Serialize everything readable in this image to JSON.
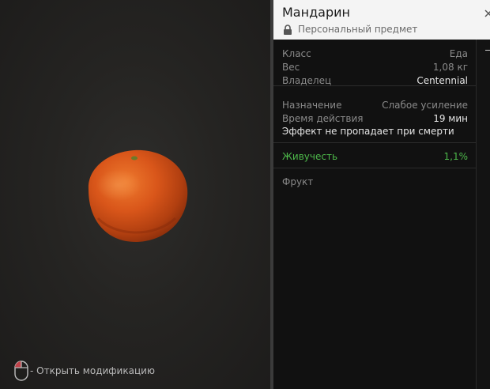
{
  "item": {
    "name": "Мандарин",
    "ownership": "Персональный предмет"
  },
  "props": [
    {
      "label": "Класс",
      "value": "Еда"
    },
    {
      "label": "Вес",
      "value": "1,08 кг"
    },
    {
      "label": "Владелец",
      "value": "Centennial"
    }
  ],
  "effect": {
    "purpose_label": "Назначение",
    "purpose_value": "Слабое усиление",
    "duration_label": "Время действия",
    "duration_value": "19 мин",
    "note": "Эффект не пропадает при смерти"
  },
  "stat": {
    "label": "Живучесть",
    "value": "1,1%"
  },
  "category": "Фрукт",
  "hint": "- Открыть модификацию",
  "colors": {
    "stat_green": "#4db84a",
    "fruit_orange": "#d9561a"
  },
  "icons": {
    "lock": "lock-icon",
    "mouse": "mouse-icon",
    "close": "close-icon"
  }
}
